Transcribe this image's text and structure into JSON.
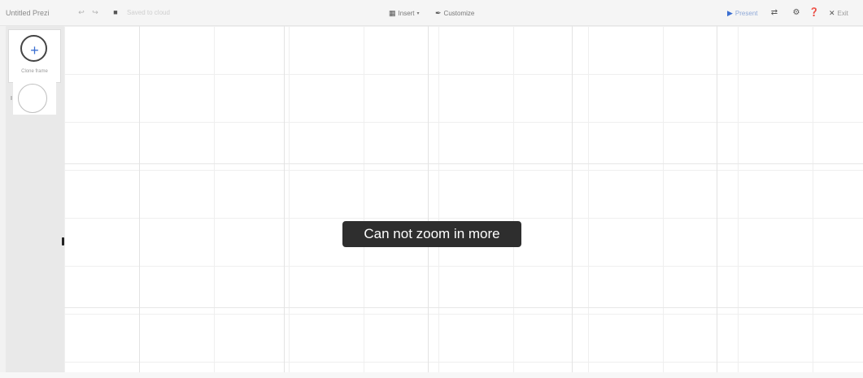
{
  "toolbar": {
    "doc_title": "Untitled Prezi",
    "undo_icon": "undo-icon",
    "redo_icon": "redo-icon",
    "save_icon": "save-icon",
    "save_status": "Saved to cloud",
    "insert_label": "Insert",
    "customize_label": "Customize",
    "present_label": "Present",
    "exit_label": "Exit"
  },
  "sidebar": {
    "add_frame_label": "Clone frame"
  },
  "canvas": {
    "toast_message": "Can not zoom in more"
  },
  "colors": {
    "accent": "#3b6fd1",
    "toast_bg": "#2e2e2e",
    "sidebar_bg": "#e9e9e9",
    "toolbar_bg": "#f5f5f5"
  }
}
